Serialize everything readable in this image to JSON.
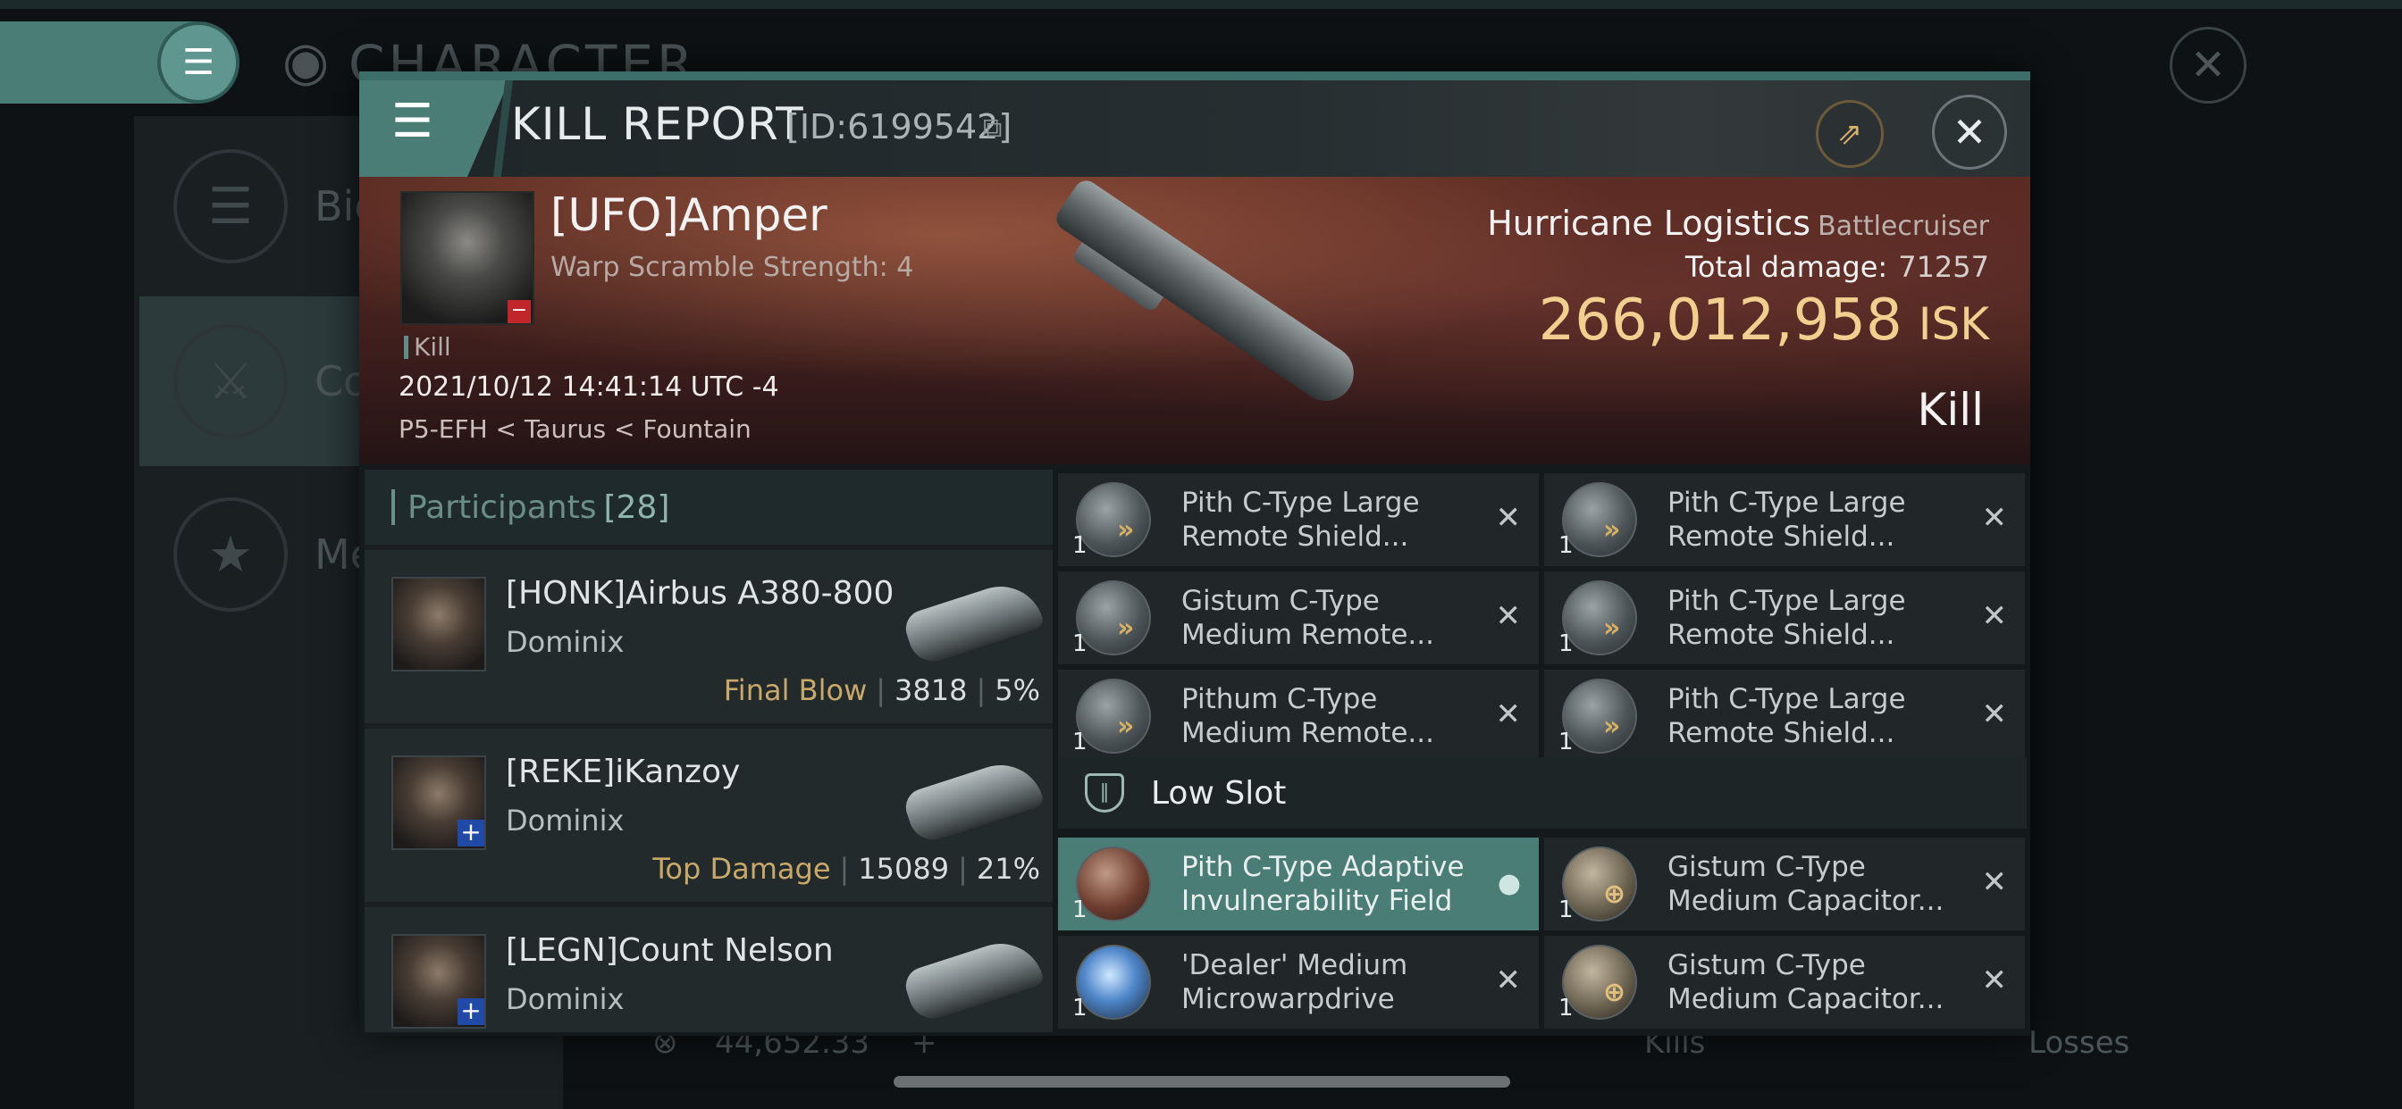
{
  "background": {
    "app_title": "CHARACTER",
    "side_items": [
      {
        "label": "Bio",
        "icon": "menu-icon"
      },
      {
        "label": "Co",
        "icon": "crossed-swords-icon"
      },
      {
        "label": "Me",
        "icon": "star-medal-icon"
      }
    ],
    "bottom": {
      "isk_value": "44,652.33",
      "kills_label": "Kills",
      "losses_label": "Losses"
    }
  },
  "window": {
    "title": "KILL REPORT",
    "id": "[ID:6199542]",
    "copy_icon": "copy-icon",
    "share_icon": "share-icon",
    "close_icon": "close-icon"
  },
  "banner": {
    "pilot_name": "[UFO]Amper",
    "warp_scramble": "Warp Scramble Strength: 4",
    "kill_tag": "Kill",
    "datetime": "2021/10/12 14:41:14 UTC -4",
    "location": "P5-EFH < Taurus < Fountain",
    "ship_name": "Hurricane Logistics",
    "ship_class": "Battlecruiser",
    "total_damage_label": "Total damage:",
    "total_damage": "71257",
    "isk_value": "266,012,958",
    "isk_unit": "ISK",
    "result_label": "Kill"
  },
  "participants": {
    "label": "Participants",
    "count": "[28]",
    "rows": [
      {
        "name": "[HONK]Airbus A380-800",
        "ship": "Dominix",
        "tag": "Final Blow",
        "damage": "3818",
        "percent": "5%"
      },
      {
        "name": "[REKE]iKanzoy",
        "ship": "Dominix",
        "tag": "Top Damage",
        "damage": "15089",
        "percent": "21%"
      },
      {
        "name": "[LEGN]Count Nelson",
        "ship": "Dominix",
        "tag": "",
        "damage": "",
        "percent": ""
      }
    ]
  },
  "modules": {
    "mid": [
      {
        "name": "Pith C-Type Large Remote Shield...",
        "qty": "1"
      },
      {
        "name": "Pith C-Type Large Remote Shield...",
        "qty": "1"
      },
      {
        "name": "Gistum C-Type Medium Remote...",
        "qty": "1"
      },
      {
        "name": "Pith C-Type Large Remote Shield...",
        "qty": "1"
      },
      {
        "name": "Pithum C-Type Medium Remote...",
        "qty": "1"
      },
      {
        "name": "Pith C-Type Large Remote Shield...",
        "qty": "1"
      }
    ],
    "low_slot_label": "Low Slot",
    "low": [
      {
        "name": "Pith C-Type Adaptive Invulnerability Field",
        "qty": "1"
      },
      {
        "name": "Gistum C-Type Medium Capacitor...",
        "qty": "1"
      },
      {
        "name": "'Dealer' Medium Microwarpdrive",
        "qty": "1"
      },
      {
        "name": "Gistum C-Type Medium Capacitor...",
        "qty": "1"
      }
    ]
  }
}
